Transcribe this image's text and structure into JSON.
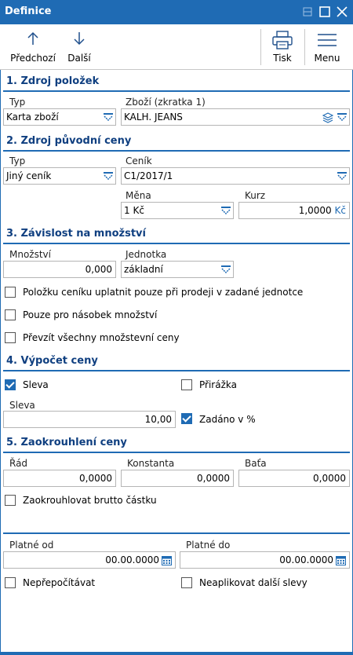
{
  "window": {
    "title": "Definice"
  },
  "toolbar": {
    "prev_label": "Předchozí",
    "next_label": "Další",
    "print_label": "Tisk",
    "menu_label": "Menu"
  },
  "s1": {
    "title": "1. Zdroj položek",
    "typ_label": "Typ",
    "typ_value": "Karta zboží",
    "zbozi_label": "Zboží (zkratka 1)",
    "zbozi_value": "KALH. JEANS"
  },
  "s2": {
    "title": "2. Zdroj původní ceny",
    "typ_label": "Typ",
    "typ_value": "Jiný ceník",
    "cenik_label": "Ceník",
    "cenik_value": "C1/2017/1",
    "mena_label": "Měna",
    "mena_value": "1 Kč",
    "kurz_label": "Kurz",
    "kurz_value": "1,0000",
    "kurz_unit": "Kč"
  },
  "s3": {
    "title": "3. Závislost na množství",
    "mnozstvi_label": "Množství",
    "mnozstvi_value": "0,000",
    "jednotka_label": "Jednotka",
    "jednotka_value": "základní",
    "cb1": "Položku ceníku uplatnit pouze při prodeji v zadané jednotce",
    "cb2": "Pouze pro násobek množství",
    "cb3": "Převzít všechny množstevní ceny"
  },
  "s4": {
    "title": "4. Výpočet ceny",
    "sleva_cb": "Sleva",
    "sleva_checked": true,
    "prirazka_cb": "Přirážka",
    "prirazka_checked": false,
    "sleva_label": "Sleva",
    "sleva_value": "10,00",
    "zadano_cb": "Zadáno v %",
    "zadano_checked": true
  },
  "s5": {
    "title": "5. Zaokrouhlení ceny",
    "rad_label": "Řád",
    "rad_value": "0,0000",
    "konst_label": "Konstanta",
    "konst_value": "0,0000",
    "bata_label": "Baťa",
    "bata_value": "0,0000",
    "brutto_cb": "Zaokrouhlovat brutto částku"
  },
  "validity": {
    "od_label": "Platné od",
    "od_value": "00.00.0000",
    "do_label": "Platné do",
    "do_value": "00.00.0000",
    "neprepocitavat_cb": "Nepřepočítávat",
    "neaplikovat_cb": "Neaplikovat další slevy"
  },
  "colors": {
    "accent": "#1f6bb4",
    "section_text": "#0f3f80"
  }
}
